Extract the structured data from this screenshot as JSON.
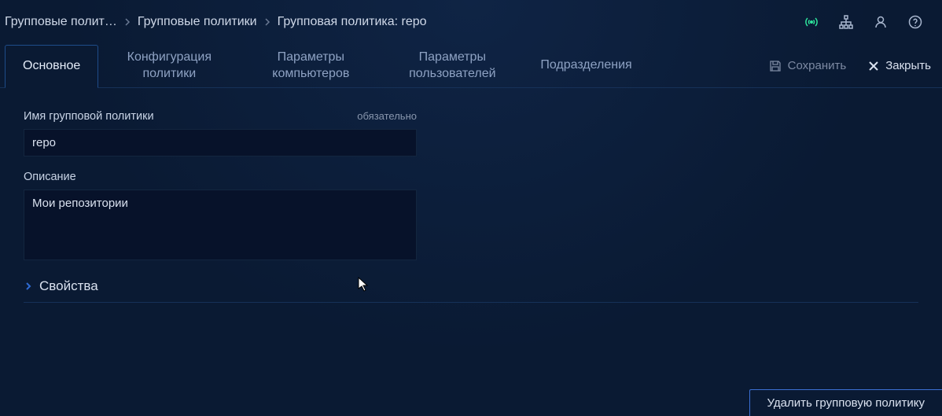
{
  "breadcrumbs": {
    "c0": "Групповые полит…",
    "c1": "Групповые политики",
    "c2": "Групповая политика: repo"
  },
  "tabs": {
    "main": "Основное",
    "policy_config": "Конфигурация политики",
    "comp_params": "Параметры компьютеров",
    "user_params": "Параметры пользователей",
    "org_units": "Подразделения"
  },
  "actions": {
    "save": "Сохранить",
    "close": "Закрыть"
  },
  "form": {
    "name_label": "Имя групповой политики",
    "name_hint": "обязательно",
    "name_value": "repo",
    "desc_label": "Описание",
    "desc_value": "Мои репозитории"
  },
  "section": {
    "properties": "Свойства"
  },
  "bottom": {
    "delete": "Удалить групповую политику"
  }
}
